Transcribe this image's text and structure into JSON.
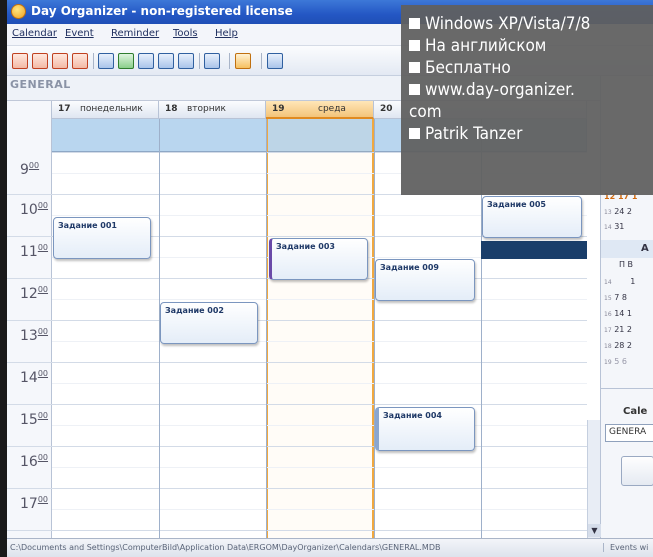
{
  "window": {
    "title": "Day Organizer - non-registered license"
  },
  "menu": [
    "Calendar",
    "Event",
    "Reminder",
    "Tools",
    "Help"
  ],
  "calendar_name": "GENERAL",
  "days": [
    {
      "num": "17",
      "name": "понедельник"
    },
    {
      "num": "18",
      "name": "вторник"
    },
    {
      "num": "19",
      "name": "среда"
    },
    {
      "num": "20",
      "name": ""
    }
  ],
  "hours": [
    {
      "h": "9",
      "m": "00"
    },
    {
      "h": "10",
      "m": "00"
    },
    {
      "h": "11",
      "m": "00"
    },
    {
      "h": "12",
      "m": "00"
    },
    {
      "h": "13",
      "m": "00"
    },
    {
      "h": "14",
      "m": "00"
    },
    {
      "h": "15",
      "m": "00"
    },
    {
      "h": "16",
      "m": "00"
    },
    {
      "h": "17",
      "m": "00"
    }
  ],
  "tasks": [
    "Задание 001",
    "Задание 002",
    "Задание 003",
    "Задание 009",
    "Задание 004",
    "Задание 005"
  ],
  "mini_calendar": {
    "row_a": {
      "wk": "12",
      "text": "17 1"
    },
    "row_b": {
      "wk": "13",
      "text": "24 2"
    },
    "row_c": {
      "wk": "14",
      "text": "31"
    },
    "month_initial": "А",
    "weekday_header": "П  В",
    "row_1": {
      "wk": "14",
      "text": "1"
    },
    "row_2": {
      "wk": "15",
      "text": "7  8"
    },
    "row_3": {
      "wk": "16",
      "text": "14 1"
    },
    "row_4": {
      "wk": "17",
      "text": "21 2"
    },
    "row_5": {
      "wk": "18",
      "text": "28 2"
    },
    "row_6": {
      "wk": "19",
      "text": "5  6"
    }
  },
  "side_panel": {
    "cale_label": "Cale",
    "calendar_value": "GENERA"
  },
  "statusbar": {
    "path": "C:\\Documents and Settings\\ComputerBild\\Application Data\\ERGOM\\DayOrganizer\\Calendars\\GENERAL.MDB",
    "right": "Events wi"
  },
  "overlay": {
    "lines": [
      "Windows XP/Vista/7/8",
      "На английском",
      "Бесплатно",
      "www.day-organizer.",
      "com",
      "Patrik Tanzer"
    ],
    "bullet_lines": [
      true,
      true,
      true,
      true,
      false,
      true
    ]
  }
}
